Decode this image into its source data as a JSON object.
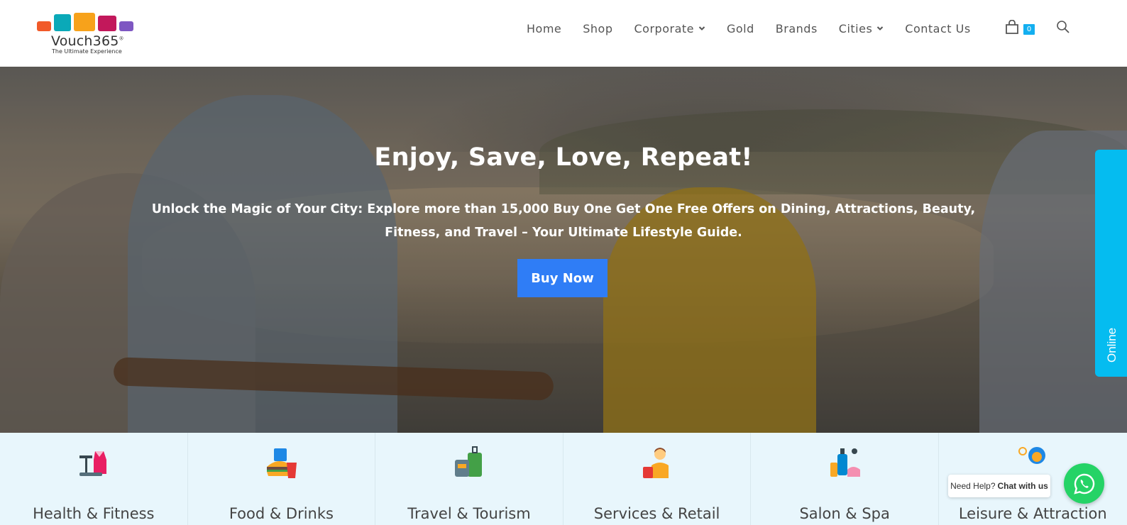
{
  "brand": {
    "name": "Vouch365",
    "registered": "®",
    "tagline": "The Ultimate Experience",
    "icon_colors": [
      "#f15a29",
      "#0aa9b8",
      "#f7a21b",
      "#c2185b",
      "#7e57c2"
    ]
  },
  "nav": {
    "items": [
      {
        "label": "Home",
        "dropdown": false
      },
      {
        "label": "Shop",
        "dropdown": false
      },
      {
        "label": "Corporate",
        "dropdown": true
      },
      {
        "label": "Gold",
        "dropdown": false
      },
      {
        "label": "Brands",
        "dropdown": false
      },
      {
        "label": "Cities",
        "dropdown": true
      },
      {
        "label": "Contact Us",
        "dropdown": false
      }
    ],
    "cart_count": "0",
    "cart_icon": "shopping-bag-icon",
    "search_icon": "search-icon"
  },
  "hero": {
    "title": "Enjoy, Save, Love, Repeat!",
    "subtitle": "Unlock the Magic of Your City: Explore more than 15,000 Buy One Get One Free Offers on Dining, Attractions, Beauty, Fitness, and Travel – Your Ultimate Lifestyle Guide.",
    "button": "Buy Now",
    "button_color": "#2f7df6"
  },
  "online_tab": {
    "label": "Online",
    "color": "#05bcf0"
  },
  "categories": [
    {
      "label": "Health & Fitness",
      "icon": "fitness-icon"
    },
    {
      "label": "Food & Drinks",
      "icon": "food-drinks-icon"
    },
    {
      "label": "Travel & Tourism",
      "icon": "luggage-icon"
    },
    {
      "label": "Services & Retail",
      "icon": "shopper-icon"
    },
    {
      "label": "Salon & Spa",
      "icon": "spa-products-icon"
    },
    {
      "label": "Leisure & Attraction",
      "icon": "leisure-icon"
    }
  ],
  "chat": {
    "help_text": "Need Help?",
    "chat_text": "Chat with us",
    "whatsapp_icon": "whatsapp-icon",
    "whatsapp_color": "#25d366"
  }
}
